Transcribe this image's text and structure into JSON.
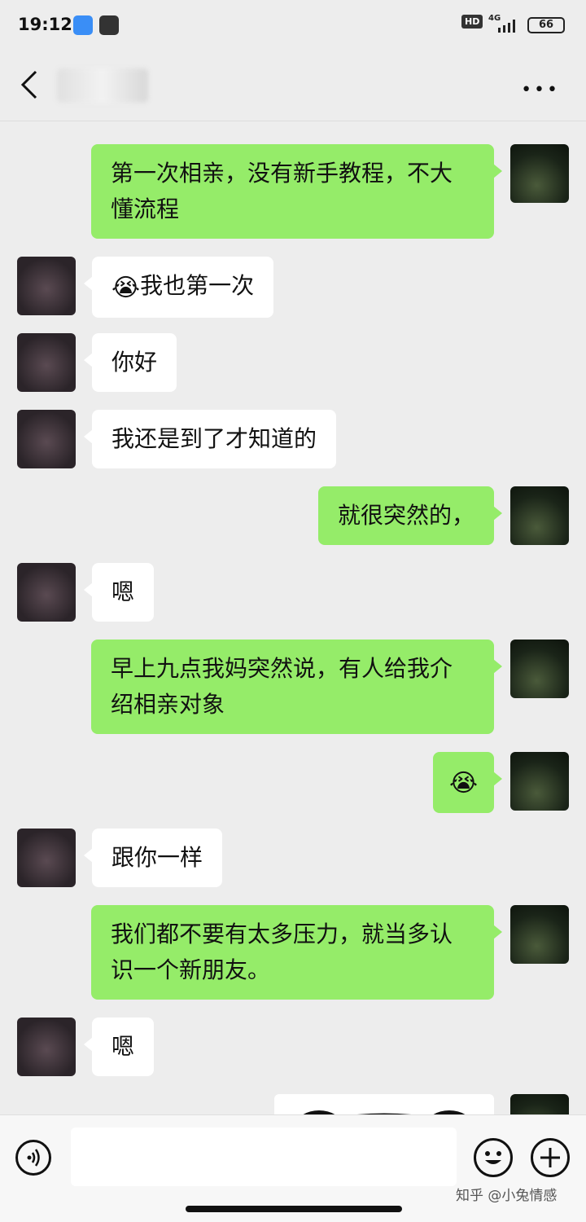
{
  "status_bar": {
    "time": "19:12",
    "hd": "HD",
    "network": "4G",
    "battery": "66"
  },
  "header": {
    "back_icon": "chevron-left-icon",
    "more_icon": "more-dots-icon"
  },
  "messages": [
    {
      "side": "mine",
      "text": "第一次相亲，没有新手教程，不大懂流程"
    },
    {
      "side": "theirs",
      "emoji": "😭",
      "text": "我也第一次"
    },
    {
      "side": "theirs",
      "text": "你好"
    },
    {
      "side": "theirs",
      "text": "我还是到了才知道的"
    },
    {
      "side": "mine",
      "text": "就很突然的，"
    },
    {
      "side": "theirs",
      "text": "嗯"
    },
    {
      "side": "mine",
      "text": "早上九点我妈突然说，有人给我介绍相亲对象"
    },
    {
      "side": "mine",
      "emoji": "😭",
      "text": ""
    },
    {
      "side": "theirs",
      "text": "跟你一样"
    },
    {
      "side": "mine",
      "text": "我们都不要有太多压力，就当多认识一个新朋友。"
    },
    {
      "side": "theirs",
      "text": "嗯"
    }
  ],
  "input_bar": {
    "voice_icon": "voice-icon",
    "emoji_icon": "emoji-icon",
    "plus_icon": "plus-icon"
  },
  "watermark": {
    "text": "知乎 @小兔情感"
  },
  "colors": {
    "mine_bubble": "#95ec69",
    "theirs_bubble": "#ffffff",
    "background": "#ededed"
  }
}
